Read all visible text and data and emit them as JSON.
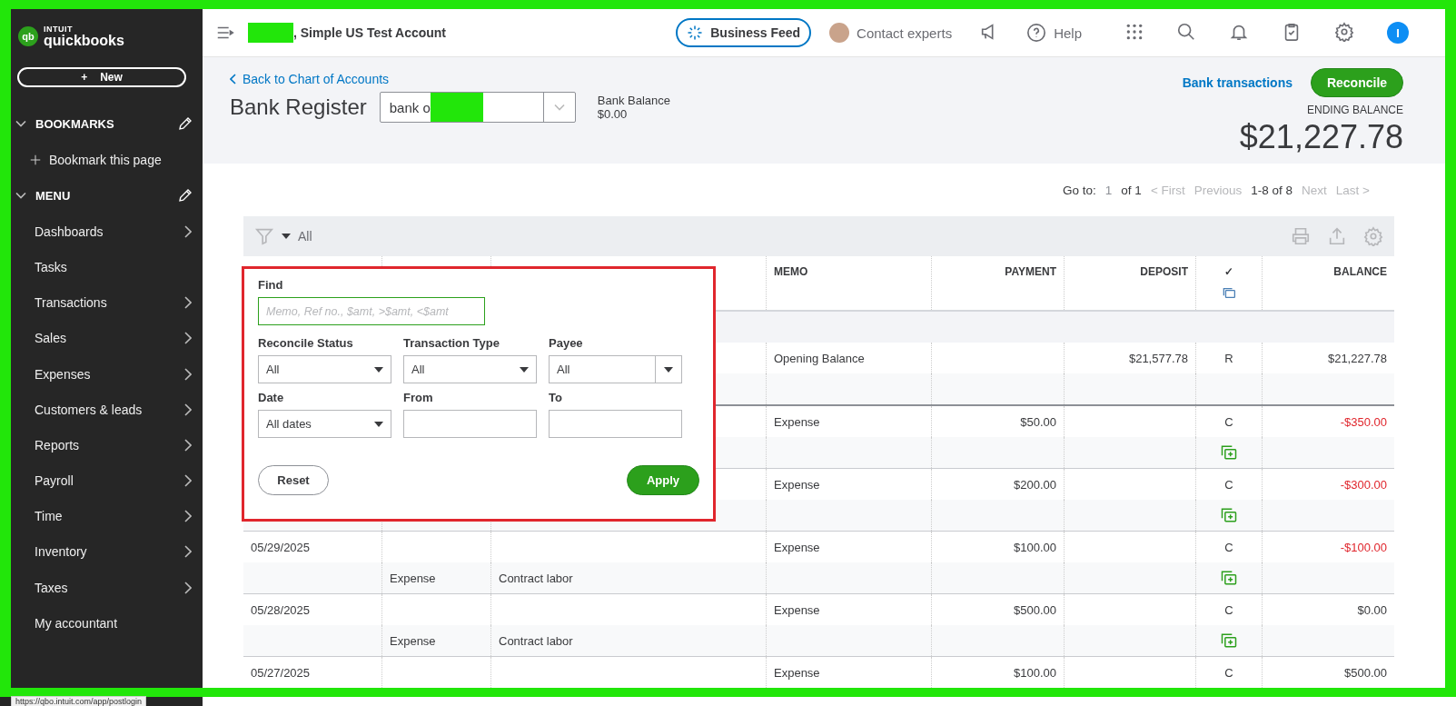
{
  "sidebar": {
    "logo": {
      "brand_top": "INTUIT",
      "brand": "quickbooks",
      "mark": "qb"
    },
    "new_button": {
      "icon": "+",
      "label": "New"
    },
    "sections": [
      {
        "title": "BOOKMARKS",
        "expanded": true,
        "items": [
          {
            "label": "Bookmark this page",
            "kind": "add"
          }
        ]
      },
      {
        "title": "MENU",
        "expanded": true,
        "items": [
          {
            "label": "Dashboards",
            "kind": "submenu"
          },
          {
            "label": "Tasks",
            "kind": "plain"
          },
          {
            "label": "Transactions",
            "kind": "submenu"
          },
          {
            "label": "Sales",
            "kind": "submenu"
          },
          {
            "label": "Expenses",
            "kind": "submenu"
          },
          {
            "label": "Customers & leads",
            "kind": "submenu"
          },
          {
            "label": "Reports",
            "kind": "submenu"
          },
          {
            "label": "Payroll",
            "kind": "submenu"
          },
          {
            "label": "Time",
            "kind": "submenu"
          },
          {
            "label": "Inventory",
            "kind": "submenu"
          },
          {
            "label": "Taxes",
            "kind": "submenu"
          },
          {
            "label": "My accountant",
            "kind": "plain"
          }
        ]
      }
    ]
  },
  "topbar": {
    "company": ", Simple US Test Account",
    "business_feed": "Business Feed",
    "contact": "Contact experts",
    "help": "Help",
    "user_initial": "I"
  },
  "header": {
    "back_link": "Back to Chart of Accounts",
    "title": "Bank Register",
    "account_value": "bank o",
    "bank_balance_label": "Bank Balance",
    "bank_balance": "$0.00",
    "bank_transactions": "Bank transactions",
    "reconcile": "Reconcile",
    "ending_label": "ENDING BALANCE",
    "ending_balance": "$21,227.78"
  },
  "pagination": {
    "goto_label": "Go to:",
    "page": "1",
    "of": "of 1",
    "items": [
      {
        "label": "< First",
        "disabled": true
      },
      {
        "label": "Previous",
        "disabled": true
      },
      {
        "label": "1-8 of 8",
        "disabled": false
      },
      {
        "label": "Next",
        "disabled": true
      },
      {
        "label": "Last >",
        "disabled": true
      }
    ]
  },
  "table": {
    "filter_label": "All",
    "columns": [
      {
        "label": "MEMO"
      },
      {
        "label": "PAYMENT"
      },
      {
        "label": "DEPOSIT"
      },
      {
        "label": "✓"
      },
      {
        "label": "BALANCE"
      }
    ],
    "rows": [
      {
        "memo": "Opening Balance",
        "deposit": "$21,577.78",
        "status": "R",
        "balance": "$21,227.78",
        "negative": false,
        "split_icon": false
      },
      {
        "memo": "Expense",
        "payment": "$50.00",
        "status": "C",
        "balance": "-$350.00",
        "negative": true,
        "split_icon": true
      },
      {
        "memo": "Expense",
        "payment": "$200.00",
        "status": "C",
        "balance": "-$300.00",
        "negative": true,
        "split_icon": true
      },
      {
        "date": "05/29/2025",
        "type": "Expense",
        "account": "Contract labor",
        "memo": "Expense",
        "payment": "$100.00",
        "status": "C",
        "balance": "-$100.00",
        "negative": true,
        "split_icon": true
      },
      {
        "date": "05/28/2025",
        "type": "Expense",
        "account": "Contract labor",
        "memo": "Expense",
        "payment": "$500.00",
        "status": "C",
        "balance": "$0.00",
        "negative": false,
        "split_icon": true
      },
      {
        "date": "05/27/2025",
        "memo": "Expense",
        "payment": "$100.00",
        "status": "C",
        "balance": "$500.00",
        "negative": false
      }
    ]
  },
  "filter_popup": {
    "find_label": "Find",
    "find_placeholder": "Memo, Ref no., $amt, >$amt, <$amt",
    "fields": [
      {
        "label": "Reconcile Status",
        "value": "All",
        "kind": "select"
      },
      {
        "label": "Transaction Type",
        "value": "All",
        "kind": "select"
      },
      {
        "label": "Payee",
        "value": "All",
        "kind": "combo"
      },
      {
        "label": "Date",
        "value": "All dates",
        "kind": "select"
      },
      {
        "label": "From",
        "kind": "input"
      },
      {
        "label": "To",
        "kind": "input"
      }
    ],
    "reset": "Reset",
    "apply": "Apply"
  },
  "status_url": "https://qbo.intuit.com/app/postlogin"
}
